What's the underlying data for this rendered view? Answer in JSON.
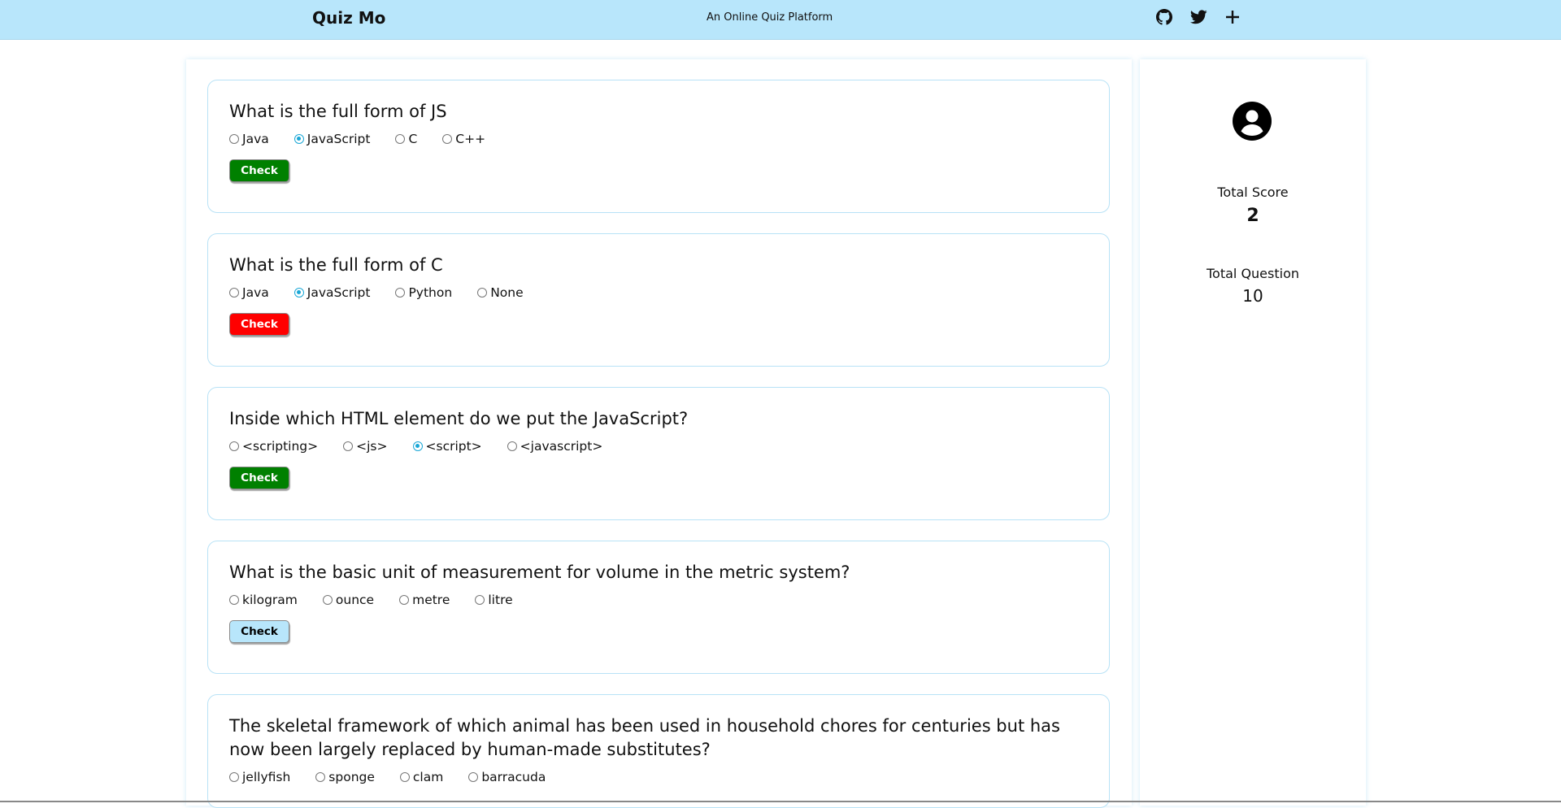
{
  "header": {
    "brand": "Quiz Mo",
    "tagline": "An Online Quiz Platform",
    "icons": [
      "github-icon",
      "twitter-icon",
      "plus-icon"
    ]
  },
  "questions": [
    {
      "text": "What is the full form of JS",
      "options": [
        "Java",
        "JavaScript",
        "C",
        "C++"
      ],
      "selected": 1,
      "check_label": "Check",
      "check_color": "#008000",
      "check_text_color": "#ffffff"
    },
    {
      "text": "What is the full form of C",
      "options": [
        "Java",
        "JavaScript",
        "Python",
        "None"
      ],
      "selected": 1,
      "check_label": "Check",
      "check_color": "#ff0000",
      "check_text_color": "#ffffff"
    },
    {
      "text": "Inside which HTML element do we put the JavaScript?",
      "options": [
        "<scripting>",
        "<js>",
        "<script>",
        "<javascript>"
      ],
      "selected": 2,
      "check_label": "Check",
      "check_color": "#008000",
      "check_text_color": "#ffffff"
    },
    {
      "text": "What is the basic unit of measurement for volume in the metric system?",
      "options": [
        "kilogram",
        "ounce",
        "metre",
        "litre"
      ],
      "selected": null,
      "check_label": "Check",
      "check_color": "#b8e6fb",
      "check_text_color": "#000000"
    },
    {
      "text": "The skeletal framework of which animal has been used in household chores for centuries but has now been largely replaced by human-made substitutes?",
      "options": [
        "jellyfish",
        "sponge",
        "clam",
        "barracuda"
      ],
      "selected": null,
      "check_label": "Check",
      "check_color": "#b8e6fb",
      "check_text_color": "#000000"
    }
  ],
  "sidebar": {
    "avatar_icon": "user-avatar-icon",
    "score_label": "Total Score",
    "score_value": "2",
    "question_label": "Total Question",
    "question_value": "10"
  },
  "colors": {
    "header_bg": "#b8e6fb",
    "card_border": "#b8e2f6",
    "radio_accent": "#1aa7d6"
  }
}
